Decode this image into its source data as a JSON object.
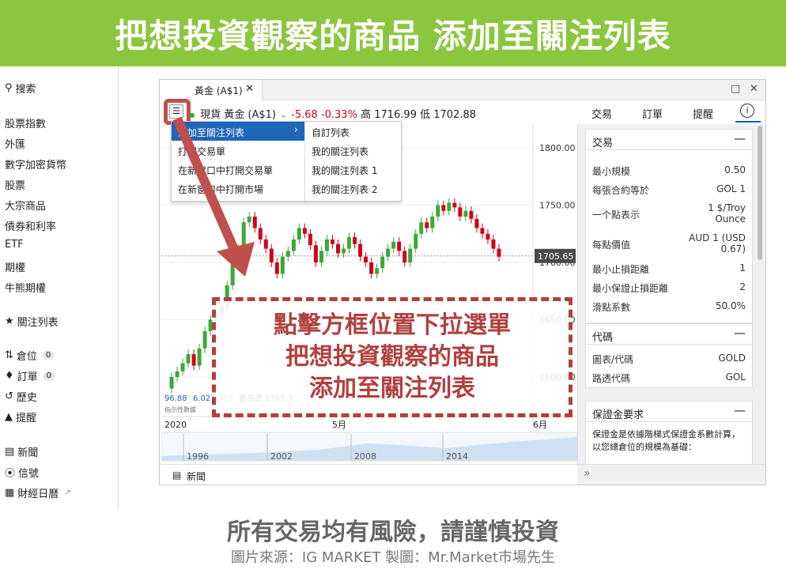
{
  "banner": {
    "title": "把想投資觀察的商品 添加至關注列表"
  },
  "leftnav": {
    "search": "搜索",
    "markets": [
      "股票指數",
      "外匯",
      "數字加密貨幣",
      "股票",
      "大宗商品",
      "債券和利率",
      "ETF",
      "期權",
      "牛熊期權"
    ],
    "watchlist": "關注列表",
    "positions": "倉位",
    "positions_count": "0",
    "orders": "訂單",
    "orders_count": "0",
    "history": "歷史",
    "alerts": "提醒",
    "news": "新聞",
    "signals": "信號",
    "calendar": "財經日曆"
  },
  "window": {
    "tab_label": "黃金 (A$1)",
    "instrument": "現貨 黃金 (A$1)",
    "change": "-5.68",
    "change_pct": "-0.33%",
    "high_low": "高 1716.99 低 1702.88",
    "right_tabs": {
      "trade": "交易",
      "orders": "訂單",
      "alerts": "提醒"
    }
  },
  "dropdown": {
    "items": [
      "添加至關注列表",
      "打開交易單",
      "在新窗口中打開交易單",
      "在新窗口中打開市場"
    ],
    "submenu": [
      "自訂列表",
      "我的關注列表",
      "我的關注列表 1",
      "我的關注列表 2"
    ]
  },
  "panel": {
    "trade": {
      "title": "交易",
      "rows": [
        {
          "label": "最小規模",
          "value": "0.50"
        },
        {
          "label": "每張合約等於",
          "value": "GOL 1"
        },
        {
          "label": "一个點表示",
          "value": "1 $/Troy Ounce"
        },
        {
          "label": "每點價值",
          "value": "AUD 1 (USD 0.67)"
        },
        {
          "label": "最小止損距離",
          "value": "1"
        },
        {
          "label": "最小保證止損距離",
          "value": "2"
        },
        {
          "label": "滑點系數",
          "value": "50.0%"
        }
      ]
    },
    "code": {
      "title": "代碼",
      "rows": [
        {
          "label": "圖表/代碼",
          "value": "GOLD"
        },
        {
          "label": "路透代碼",
          "value": "GOL"
        }
      ]
    },
    "margin": {
      "title": "保證金要求",
      "text": "保證金是依據階梯式保證金系數計算，以您總倉位的規模為基礎："
    }
  },
  "chart": {
    "price_labels": [
      "1800.00",
      "1750.00",
      "1700.00",
      "1650.00",
      "1600.00"
    ],
    "current_price": "1705.65",
    "indicator_left": "96.88",
    "indicator_pct": "6.02百分比",
    "indicator_high": "最高價 1765.3",
    "indicator_label": "指示性數據",
    "x_labels": [
      "2020",
      "5月",
      "6月"
    ],
    "nav_years": [
      "1996",
      "2002",
      "2008",
      "2014"
    ]
  },
  "bottom": {
    "news": "新聞"
  },
  "callout": [
    "點擊方框位置下拉選單",
    "把想投資觀察的商品",
    "添加至關注列表"
  ],
  "footer": {
    "risk": "所有交易均有風險，請謹慎投資",
    "source": "圖片來源：IG MARKET 製圖：Mr.Market市場先生"
  },
  "colors": {
    "banner": "#8cc63f",
    "accent_red": "#c0504d",
    "up": "#3aa83a",
    "down": "#d0021b",
    "select_blue": "#1f66b9"
  }
}
